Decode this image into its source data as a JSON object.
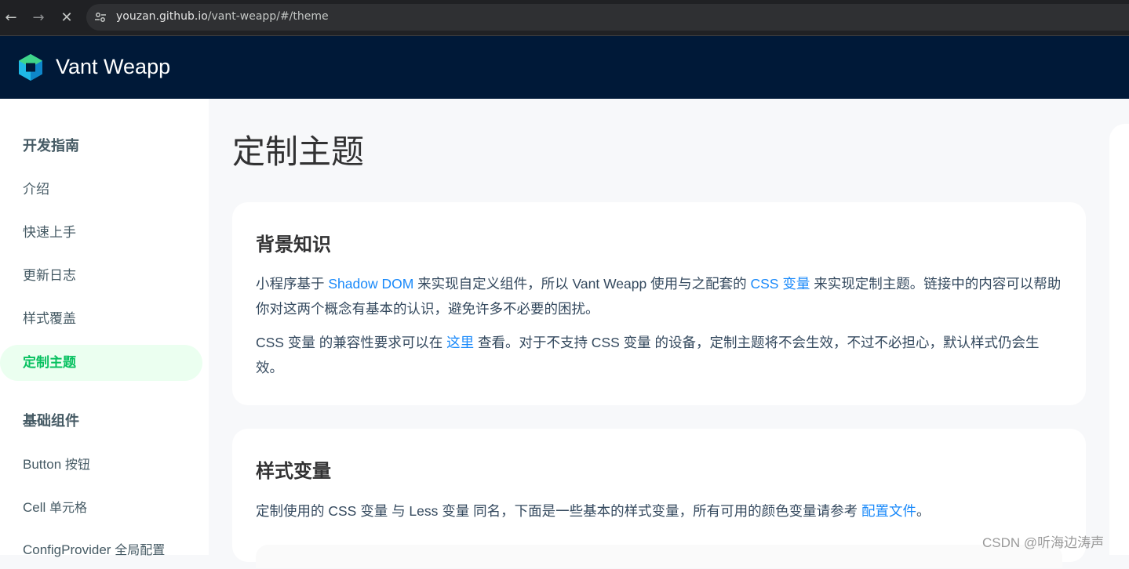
{
  "browser": {
    "url_host": "youzan.github.io",
    "url_path": "/vant-weapp/#/theme"
  },
  "header": {
    "brand": "Vant Weapp"
  },
  "sidebar": {
    "groups": [
      {
        "title": "开发指南"
      },
      {
        "title": "基础组件"
      }
    ],
    "guide_items": [
      {
        "label": "介绍"
      },
      {
        "label": "快速上手"
      },
      {
        "label": "更新日志"
      },
      {
        "label": "样式覆盖"
      },
      {
        "label": "定制主题"
      }
    ],
    "basic_items": [
      {
        "label": "Button",
        "sub": "按钮"
      },
      {
        "label": "Cell",
        "sub": "单元格"
      },
      {
        "label": "ConfigProvider",
        "sub": "全局配置"
      }
    ]
  },
  "main": {
    "title": "定制主题",
    "card1": {
      "heading": "背景知识",
      "p1_a": "小程序基于 ",
      "p1_link1": "Shadow DOM",
      "p1_b": " 来实现自定义组件，所以 Vant Weapp 使用与之配套的 ",
      "p1_link2": "CSS 变量",
      "p1_c": " 来实现定制主题。链接中的内容可以帮助你对这两个概念有基本的认识，避免许多不必要的困扰。",
      "p2_a": "CSS 变量 的兼容性要求可以在 ",
      "p2_link": "这里",
      "p2_b": " 查看。对于不支持 CSS 变量 的设备，定制主题将不会生效，不过不必担心，默认样式仍会生效。"
    },
    "card2": {
      "heading": "样式变量",
      "p1_a": "定制使用的 CSS 变量 与 Less 变量 同名，下面是一些基本的样式变量，所有可用的颜色变量请参考 ",
      "p1_link": "配置文件",
      "p1_b": "。"
    }
  },
  "watermark": "CSDN @听海边涛声",
  "colors": {
    "header_bg": "#001938",
    "accent_green": "#07c160",
    "link_blue": "#1989fa",
    "active_bg": "#ebfff0"
  }
}
